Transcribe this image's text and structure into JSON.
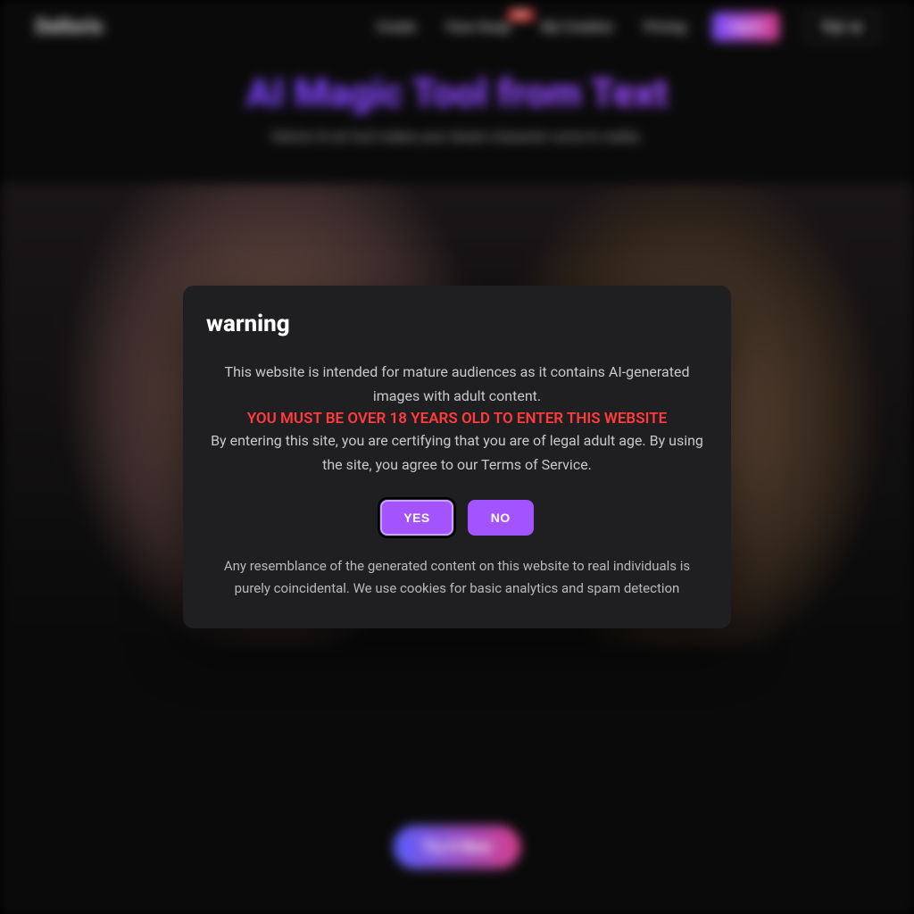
{
  "brand": "Delloris",
  "nav": {
    "items": [
      {
        "label": "Create"
      },
      {
        "label": "Face Swap",
        "badge": "NEW"
      },
      {
        "label": "My Creation"
      },
      {
        "label": "Pricing"
      }
    ],
    "login": "Log in",
    "signup": "Sign up"
  },
  "hero": {
    "title": "AI Magic Tool from Text",
    "subtitle": "Deloris AI art tool makes your dream character come to reality.",
    "cta": "Try it Now"
  },
  "modal": {
    "title": "warning",
    "p1": "This website is intended for mature audiences as it contains AI-generated images with adult content.",
    "age_warning": "YOU MUST BE OVER 18 YEARS OLD TO ENTER THIS WEBSITE",
    "p2": "By entering this site, you are certifying that you are of legal adult age. By using the site, you agree to our Terms of Service.",
    "yes": "YES",
    "no": "NO",
    "footer": "Any resemblance of the generated content on this website to real individuals is purely coincidental. We use cookies for basic analytics and spam detection"
  }
}
